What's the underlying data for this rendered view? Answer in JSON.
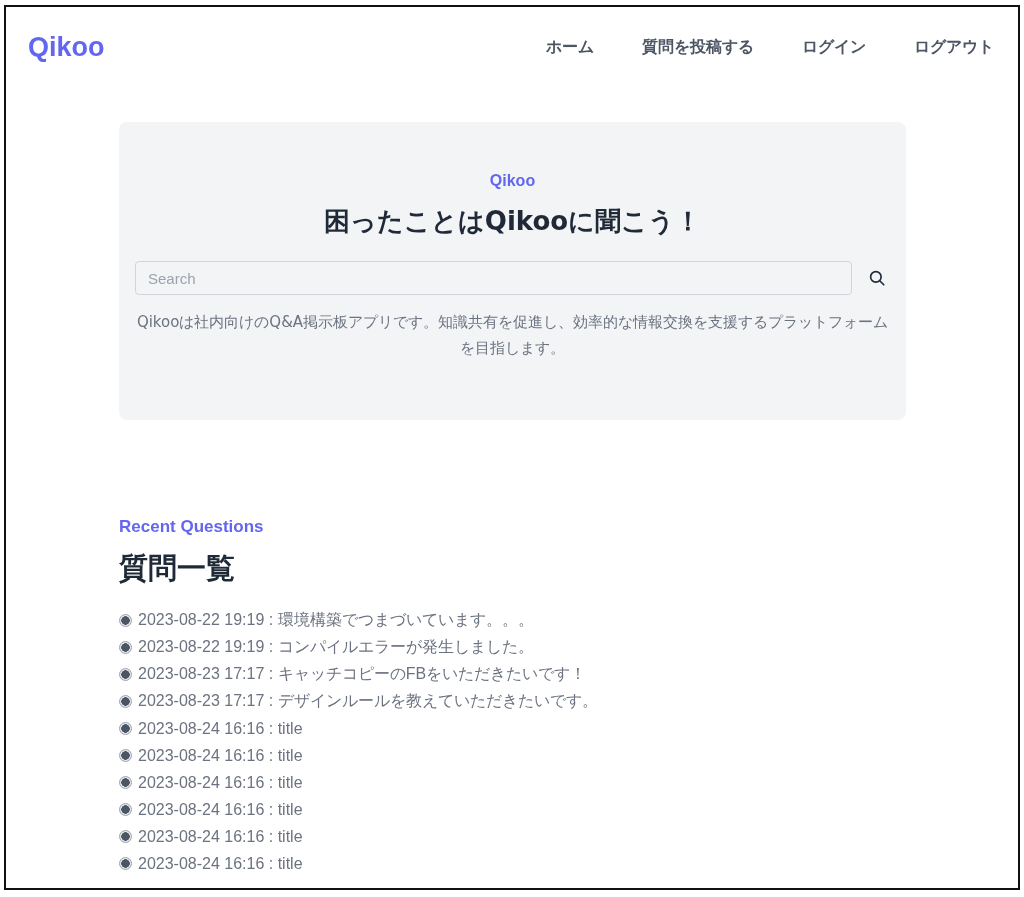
{
  "header": {
    "logo": "Qikoo",
    "nav": [
      "ホーム",
      "質問を投稿する",
      "ログイン",
      "ログアウト"
    ]
  },
  "hero": {
    "eyebrow": "Qikoo",
    "title": "困ったことはQikooに聞こう！",
    "search": {
      "placeholder": "Search"
    },
    "description": "Qikooは社内向けのQ&A掲示板アプリです。知識共有を促進し、効率的な情報交換を支援するプラットフォームを目指します。"
  },
  "recent": {
    "eyebrow": "Recent Questions",
    "title": "質問一覧",
    "questions": [
      "2023-08-22 19:19 : 環境構築でつまづいています。。。",
      "2023-08-22 19:19 : コンパイルエラーが発生しました。",
      "2023-08-23 17:17 : キャッチコピーのFBをいただきたいです！",
      "2023-08-23 17:17 : デザインルールを教えていただきたいです。",
      "2023-08-24 16:16 : title",
      "2023-08-24 16:16 : title",
      "2023-08-24 16:16 : title",
      "2023-08-24 16:16 : title",
      "2023-08-24 16:16 : title",
      "2023-08-24 16:16 : title"
    ]
  }
}
